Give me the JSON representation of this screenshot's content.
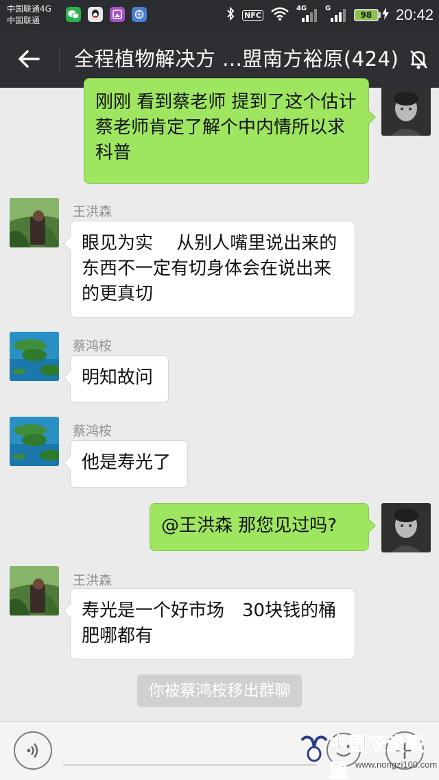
{
  "status_bar": {
    "carrier_line1": "中国联通4G",
    "carrier_line2": "中国联通",
    "nfc": "NFC",
    "net_4g": "4G",
    "net_g": "G",
    "battery": "98",
    "time": "20:42",
    "app_icons": [
      "wechat-icon",
      "qq-icon",
      "gallery-icon",
      "browser-icon"
    ]
  },
  "header": {
    "title": "全程植物解决方 ...盟南方裕原(424)"
  },
  "messages": [
    {
      "side": "right",
      "text": "刚刚 看到蔡老师 提到了这个估计 蔡老师肯定了解个中内情所以求科普"
    },
    {
      "side": "left",
      "sender": "王洪森",
      "text": "眼见为实　 从别人嘴里说出来的东西不一定有切身体会在说出来的更真切"
    },
    {
      "side": "left",
      "sender": "蔡鸿桉",
      "text": "明知故问"
    },
    {
      "side": "left",
      "sender": "蔡鸿桉",
      "text": "他是寿光了"
    },
    {
      "side": "right",
      "text": "@王洪森 那您见过吗?"
    },
    {
      "side": "left",
      "sender": "王洪森",
      "text": "寿光是一个好市场　30块钱的桶肥哪都有"
    }
  ],
  "system_notice": "你被蔡鸿桉移出群聊",
  "watermark": {
    "title": "中国农资联盟",
    "url": "www.nongzi100.com"
  },
  "colors": {
    "self_bubble": "#9ee65f",
    "other_bubble": "#ffffff",
    "topbar": "#2e2f33",
    "background": "#ebebeb"
  }
}
